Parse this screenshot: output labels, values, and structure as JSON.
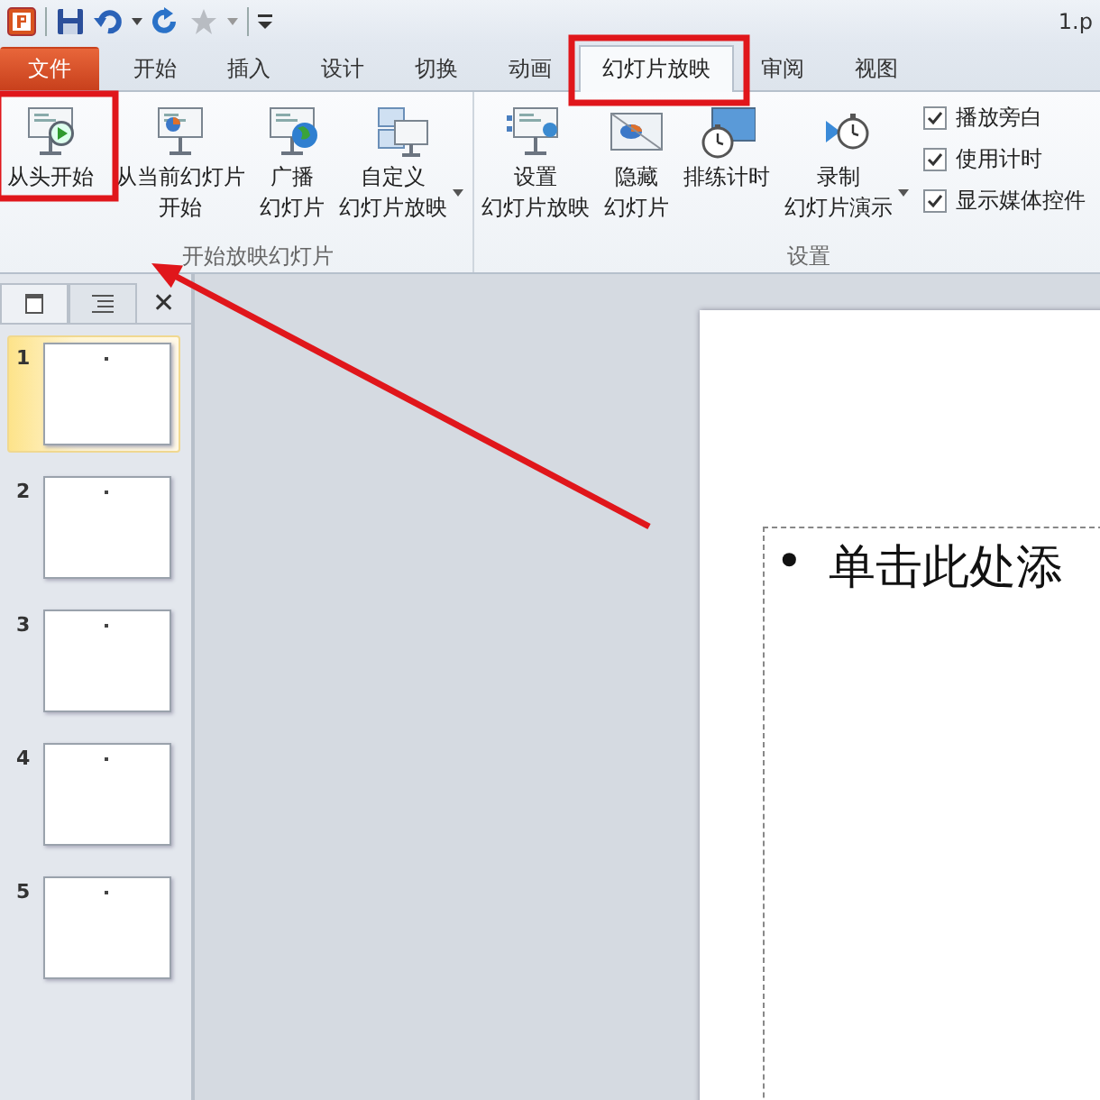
{
  "window": {
    "title": "1.p"
  },
  "tabs": [
    {
      "label": "文件",
      "kind": "file",
      "selected": false,
      "highlighted": false
    },
    {
      "label": "开始",
      "kind": "tab",
      "selected": false,
      "highlighted": false
    },
    {
      "label": "插入",
      "kind": "tab",
      "selected": false,
      "highlighted": false
    },
    {
      "label": "设计",
      "kind": "tab",
      "selected": false,
      "highlighted": false
    },
    {
      "label": "切换",
      "kind": "tab",
      "selected": false,
      "highlighted": false
    },
    {
      "label": "动画",
      "kind": "tab",
      "selected": false,
      "highlighted": false
    },
    {
      "label": "幻灯片放映",
      "kind": "tab",
      "selected": true,
      "highlighted": true
    },
    {
      "label": "审阅",
      "kind": "tab",
      "selected": false,
      "highlighted": false
    },
    {
      "label": "视图",
      "kind": "tab",
      "selected": false,
      "highlighted": false
    }
  ],
  "ribbon_groups": [
    {
      "label": "开始放映幻灯片",
      "items": [
        {
          "kind": "button",
          "lines": [
            "从头开始"
          ],
          "dropdown": false,
          "highlighted": true
        },
        {
          "kind": "button",
          "lines": [
            "从当前幻灯片",
            "开始"
          ],
          "dropdown": false,
          "highlighted": false
        },
        {
          "kind": "button",
          "lines": [
            "广播",
            "幻灯片"
          ],
          "dropdown": false,
          "highlighted": false
        },
        {
          "kind": "button",
          "lines": [
            "自定义",
            "幻灯片放映"
          ],
          "dropdown": true,
          "highlighted": false
        }
      ]
    },
    {
      "label": "设置",
      "items": [
        {
          "kind": "button",
          "lines": [
            "设置",
            "幻灯片放映"
          ],
          "dropdown": false,
          "highlighted": false
        },
        {
          "kind": "button",
          "lines": [
            "隐藏",
            "幻灯片"
          ],
          "dropdown": false,
          "highlighted": false
        },
        {
          "kind": "button",
          "lines": [
            "排练计时"
          ],
          "dropdown": false,
          "highlighted": false
        },
        {
          "kind": "button",
          "lines": [
            "录制",
            "幻灯片演示"
          ],
          "dropdown": true,
          "highlighted": false
        },
        {
          "kind": "checks",
          "checks": [
            {
              "label": "播放旁白",
              "checked": true
            },
            {
              "label": "使用计时",
              "checked": true
            },
            {
              "label": "显示媒体控件",
              "checked": true
            }
          ]
        }
      ]
    }
  ],
  "slide_panel": {
    "close": "✕",
    "slides": [
      {
        "number": "1",
        "selected": true
      },
      {
        "number": "2",
        "selected": false
      },
      {
        "number": "3",
        "selected": false
      },
      {
        "number": "4",
        "selected": false
      },
      {
        "number": "5",
        "selected": false
      }
    ]
  },
  "slide": {
    "bullet": "•",
    "text": "单击此处添"
  },
  "annotation_arrow": true
}
